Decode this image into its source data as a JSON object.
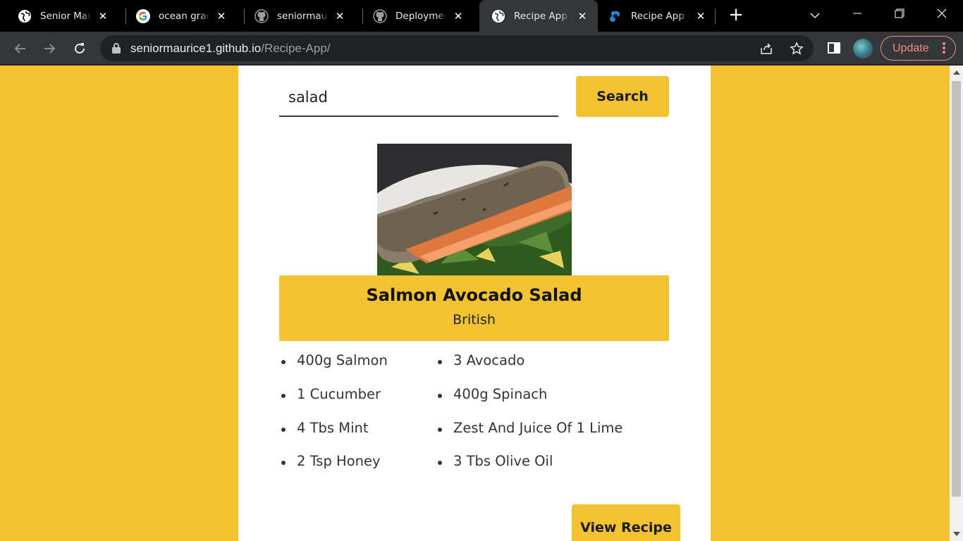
{
  "browser": {
    "tabs": [
      {
        "title": "Senior Maurice",
        "favicon": "globe-icon"
      },
      {
        "title": "ocean gradient",
        "favicon": "google-icon"
      },
      {
        "title": "seniormaurice",
        "favicon": "github-icon"
      },
      {
        "title": "Deployments",
        "favicon": "github-icon"
      },
      {
        "title": "Recipe App",
        "favicon": "globe-icon",
        "active": true
      },
      {
        "title": "Recipe App ui",
        "favicon": "figma-icon"
      }
    ],
    "url_host": "seniormaurice1.github.io",
    "url_path": "/Recipe-App/",
    "update_label": "Update"
  },
  "search": {
    "value": "salad",
    "button_label": "Search"
  },
  "meal": {
    "name": "Salmon Avocado Salad",
    "area": "British",
    "ingredients": [
      "400g Salmon",
      "3 Avocado",
      "1 Cucumber",
      "400g Spinach",
      "4 Tbs Mint",
      "Zest And Juice Of 1 Lime",
      "2 Tsp Honey",
      "3 Tbs Olive Oil"
    ],
    "view_button_label": "View Recipe"
  },
  "colors": {
    "accent": "#f2c230",
    "card": "#ffffff",
    "text": "#111111"
  }
}
